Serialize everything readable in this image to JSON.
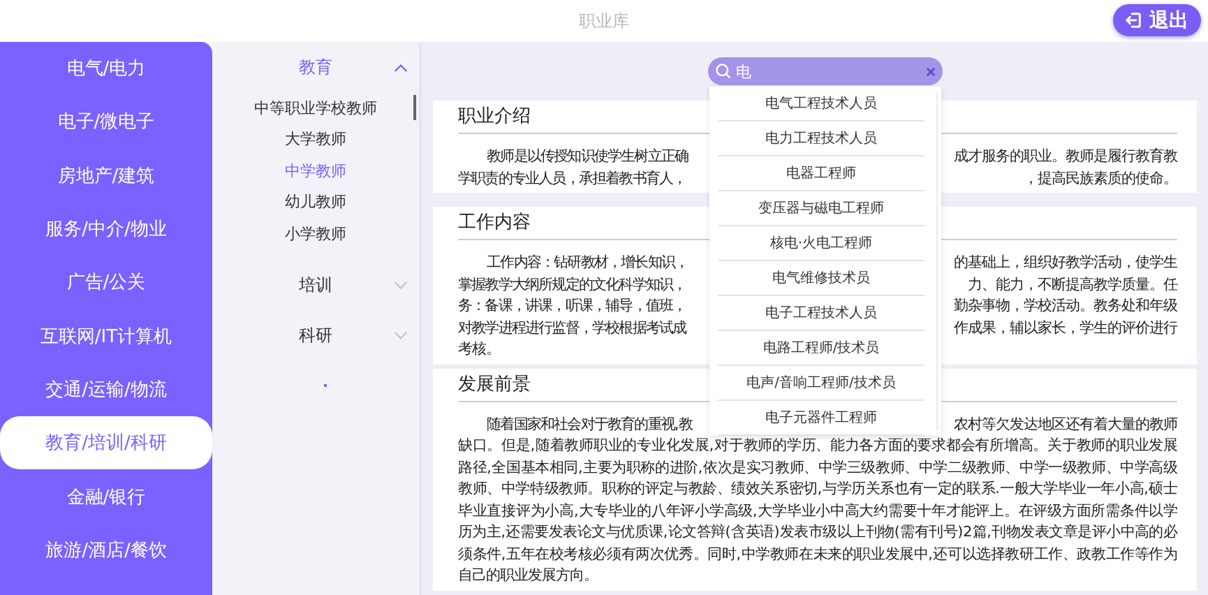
{
  "window": {
    "title": "职业库"
  },
  "logout_button": {
    "label": "退出"
  },
  "categories": [
    {
      "label": "电气/电力",
      "selected": false
    },
    {
      "label": "电子/微电子",
      "selected": false
    },
    {
      "label": "房地产/建筑",
      "selected": false
    },
    {
      "label": "服务/中介/物业",
      "selected": false
    },
    {
      "label": "广告/公关",
      "selected": false
    },
    {
      "label": "互联网/IT计算机",
      "selected": false
    },
    {
      "label": "交通/运输/物流",
      "selected": false
    },
    {
      "label": "教育/培训/科研",
      "selected": true
    },
    {
      "label": "金融/银行",
      "selected": false
    },
    {
      "label": "旅游/酒店/餐饮",
      "selected": false
    }
  ],
  "tree": [
    {
      "label": "教育",
      "expanded": true,
      "children": [
        {
          "label": "中等职业学校教师",
          "selected": false
        },
        {
          "label": "大学教师",
          "selected": false
        },
        {
          "label": "中学教师",
          "selected": true
        },
        {
          "label": "幼儿教师",
          "selected": false
        },
        {
          "label": "小学教师",
          "selected": false
        }
      ]
    },
    {
      "label": "培训",
      "expanded": false
    },
    {
      "label": "科研",
      "expanded": false
    }
  ],
  "search": {
    "value": "电",
    "suggestions": [
      "电气工程技术人员",
      "电力工程技术人员",
      "电器工程师",
      "变压器与磁电工程师",
      "核电·火电工程师",
      "电气维修技术员",
      "电子工程技术人员",
      "电路工程师/技术员",
      "电声/音响工程师/技术员",
      "电子元器件工程师"
    ]
  },
  "sections": [
    {
      "title": "职业介绍",
      "lines": [
        [
          "教师是以传授知识使学生树立正确",
          "成才服务的职业。教师是履行教育教"
        ],
        [
          "学职责的专业人员，承担着教书育人，",
          "，提高民族素质的使命。"
        ]
      ]
    },
    {
      "title": "工作内容",
      "lines": [
        [
          "工作内容：钻研教材，增长知识，",
          "的基础上，组织好教学活动，使学生"
        ],
        [
          "掌握教学大纲所规定的文化科学知识，",
          "力、能力，不断提高教学质量。任"
        ],
        [
          "务：备课，讲课，听课，辅导，值班，",
          "勤杂事物，学校活动。教务处和年级"
        ],
        [
          "对教学进程进行监督，学校根据考试成",
          "作成果，辅以家长，学生的评价进行"
        ],
        [
          "考核。"
        ]
      ]
    },
    {
      "title": "发展前景",
      "lines": [
        [
          "随着国家和社会对于教育的重视,教",
          "农村等欠发达地区还有着大量的教师"
        ],
        [
          "缺口。但是,随着教师职业的专业化发展,对于教师的学历、能力各方面的要求都会有所增高。关于教师的职业发展"
        ],
        [
          "路径,全国基本相同,主要为职称的进阶,依次是实习教师、中学三级教师、中学二级教师、中学一级教师、中学高级"
        ],
        [
          "教师、中学特级教师。职称的评定与教龄、绩效关系密切,与学历关系也有一定的联系.一般大学毕业一年小高,硕士"
        ],
        [
          "毕业直接评为小高,大专毕业的八年评小学高级,大学毕业小中高大约需要十年才能评上。在评级方面所需条件以学"
        ],
        [
          "历为主,还需要发表论文与优质课,论文答辩(含英语)发表市级以上刊物(需有刊号)2篇,刊物发表文章是评小中高的必"
        ],
        [
          "须条件,五年在校考核必须有两次优秀。同时,中学教师在未来的职业发展中,还可以选择教研工作、政教工作等作为"
        ],
        [
          "自己的职业发展方向。"
        ]
      ]
    }
  ]
}
